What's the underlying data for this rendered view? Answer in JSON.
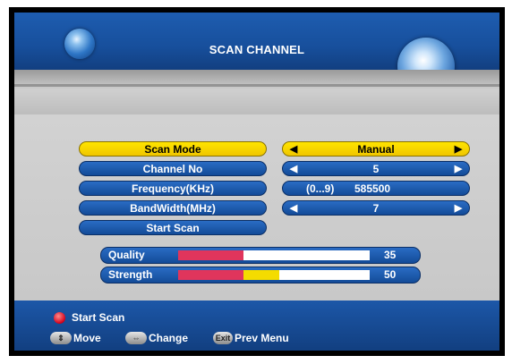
{
  "header": {
    "title": "SCAN CHANNEL"
  },
  "menu": [
    {
      "label": "Scan Mode",
      "left_arrow": "◀",
      "value": "Manual",
      "right_arrow": "▶",
      "active": true
    },
    {
      "label": "Channel No",
      "left_arrow": "◀",
      "value": "5",
      "right_arrow": "▶"
    },
    {
      "label": "Frequency(KHz)",
      "hint": "(0...9)",
      "value": "585500"
    },
    {
      "label": "BandWidth(MHz)",
      "left_arrow": "◀",
      "value": "7",
      "right_arrow": "▶"
    },
    {
      "label": "Start Scan"
    }
  ],
  "meters": {
    "quality": {
      "label": "Quality",
      "value": "35",
      "red_fraction": 0.34,
      "yellow_fraction": 0
    },
    "strength": {
      "label": "Strength",
      "value": "50",
      "red_fraction": 0.34,
      "yellow_fraction": 0.19
    }
  },
  "colors": {
    "accent_blue": "#174f9c",
    "highlight_yellow": "#ffe400",
    "meter_red": "#e0355c",
    "meter_yellow": "#f4dc00"
  },
  "footer": {
    "start_scan": "Start Scan",
    "move": "Move",
    "change": "Change",
    "exit_key": "Exit",
    "prev_menu": "Prev Menu",
    "icons": [
      "red-button-icon",
      "up-down-arrow-icon",
      "left-right-arrow-icon",
      "exit-key-icon"
    ]
  }
}
